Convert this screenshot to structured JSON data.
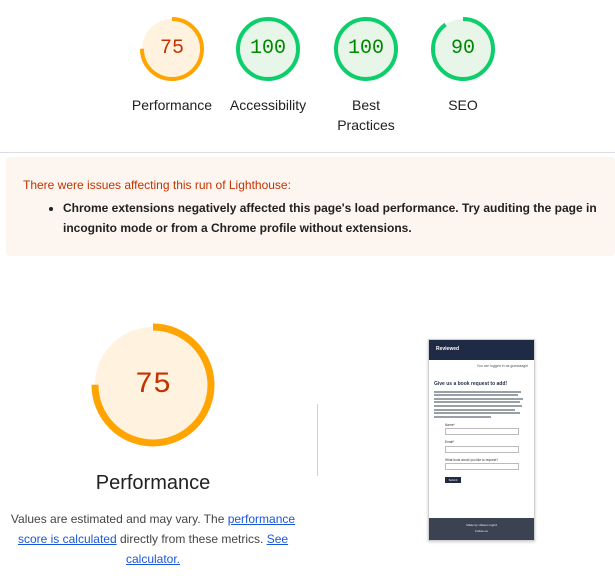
{
  "gauges": [
    {
      "score": "75",
      "label": "Performance",
      "value": 75,
      "ring": "#ffa400",
      "fill": "#fff3e0",
      "text": "#c33300"
    },
    {
      "score": "100",
      "label": "Accessibility",
      "value": 100,
      "ring": "#0cce6b",
      "fill": "#e8f5e9",
      "text": "#008800"
    },
    {
      "score": "100",
      "label": "Best\nPractices",
      "value": 100,
      "ring": "#0cce6b",
      "fill": "#e8f5e9",
      "text": "#008800"
    },
    {
      "score": "90",
      "label": "SEO",
      "value": 90,
      "ring": "#0cce6b",
      "fill": "#e8f5e9",
      "text": "#008800"
    }
  ],
  "warning": {
    "title": "There were issues affecting this run of Lighthouse:",
    "items": [
      "Chrome extensions negatively affected this page's load performance. Try auditing the page in incognito mode or from a Chrome profile without extensions."
    ]
  },
  "performance": {
    "score": "75",
    "value": 75,
    "title": "Performance",
    "desc_prefix": "Values are estimated and may vary. The ",
    "link1": "performance score is calculated",
    "desc_middle": " directly from these metrics. ",
    "link2": "See calculator.",
    "colors": {
      "ring": "#ffa400",
      "fill": "#fff3e0",
      "text": "#c33300"
    }
  },
  "screenshot": {
    "logo": "Reviewed",
    "logged_in": "You are logged in as guestaagel",
    "heading": "Give us a book request to add!",
    "fields": [
      "Name*",
      "Email*",
      "What book would you like to request?"
    ],
    "submit": "Submit",
    "made_by": "Made by Ukiwen Ingrid",
    "follow": "Follow us"
  }
}
